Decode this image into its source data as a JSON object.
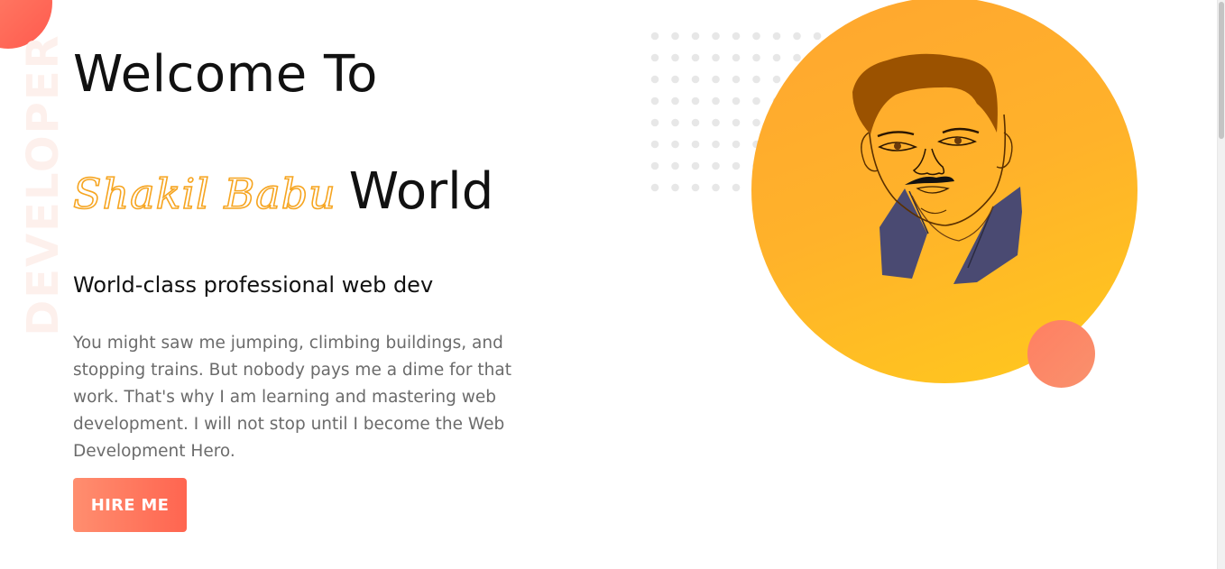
{
  "hero": {
    "vertical_word": "DEVELOPER",
    "title_line1": "Welcome To",
    "name": "Shakil Babu",
    "title_line2_suffix": "World",
    "subtitle": "World-class professional web dev",
    "description": "You might saw me jumping, climbing buildings, and stopping trains. But nobody pays me a dime for that work. That's why I am learning and mastering web development. I will not stop until I become the Web Development Hero.",
    "cta_label": "HIRE ME"
  },
  "colors": {
    "accent_orange": "#f6a521",
    "circle_gradient_start": "#ffa630",
    "circle_gradient_end": "#ffc91d",
    "cta_gradient_start": "#ff8e6f",
    "cta_gradient_end": "#ff6550",
    "shirt": "#4a4a72",
    "hair": "#9b5200"
  },
  "illustration": {
    "name": "developer-portrait"
  }
}
